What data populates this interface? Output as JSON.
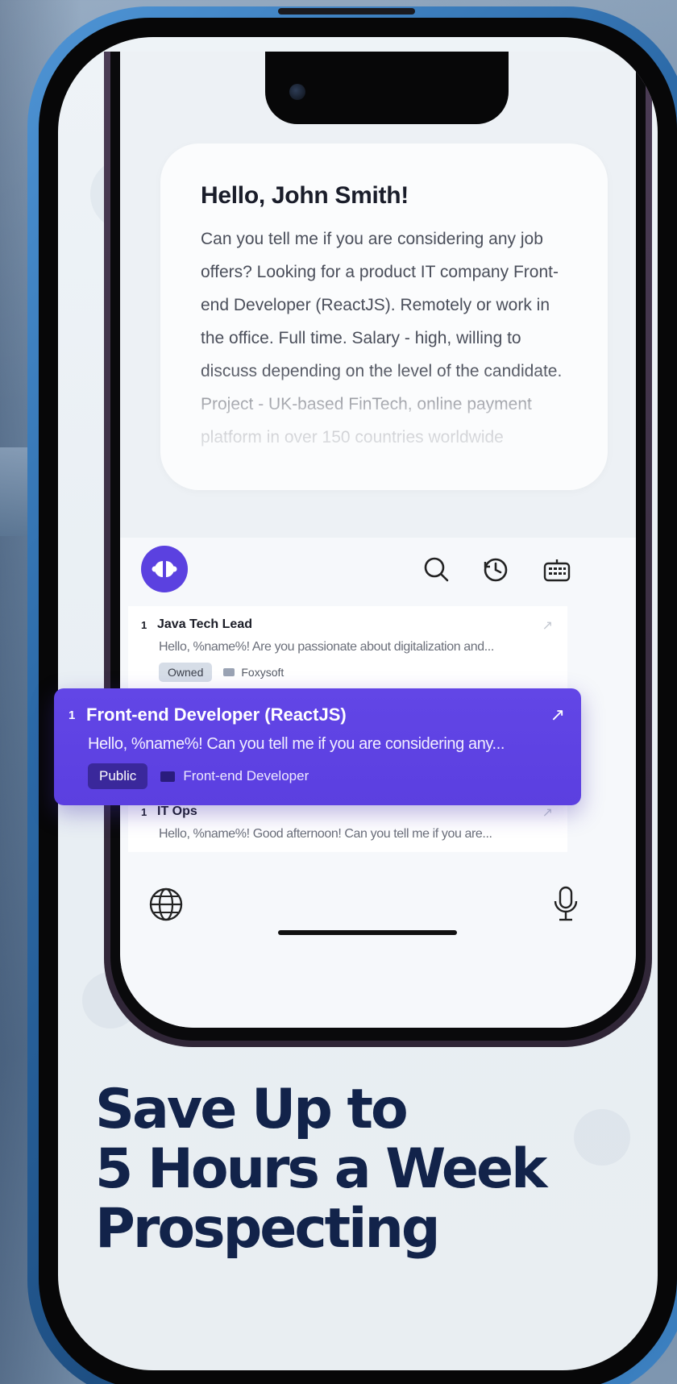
{
  "message": {
    "greeting": "Hello, John Smith!",
    "body": "Can you tell me if you are considering any job offers? Looking for a product IT company Front-end Developer (ReactJS). Remotely or work in the office. Full time. Salary - high, willing to discuss depending on the level of the candidate. Project - UK-based FinTech, online payment platform in over 150 countries worldwide"
  },
  "toolbar": {
    "logo_icon": "app-logo-icon",
    "search_icon": "search-icon",
    "history_icon": "history-icon",
    "keyboard_icon": "keyboard-icon"
  },
  "templates": [
    {
      "index": "1",
      "title": "Java Tech Lead",
      "preview": "Hello, %name%! Are you passionate about digitalization and...",
      "tag": "Owned",
      "folder": "Foxysoft"
    },
    {
      "index": "1",
      "title": "Front-end Developer (ReactJS)",
      "preview": "Hello, %name%! Can you tell me if you are considering any...",
      "tag": "Public",
      "folder": "Front-end Developer"
    },
    {
      "index": "1",
      "title": "IT Ops",
      "preview": "Hello, %name%! Good afternoon! Can you tell me if you are...",
      "tag": "",
      "folder": ""
    }
  ],
  "bottom": {
    "globe_icon": "globe-icon",
    "mic_icon": "microphone-icon"
  },
  "headline": {
    "line1": "Save Up to",
    "line2": "5 Hours a Week",
    "line3": "Prospecting"
  },
  "colors": {
    "accent": "#5b41e0",
    "headline": "#12234a",
    "frame": "#2c6aa8"
  }
}
